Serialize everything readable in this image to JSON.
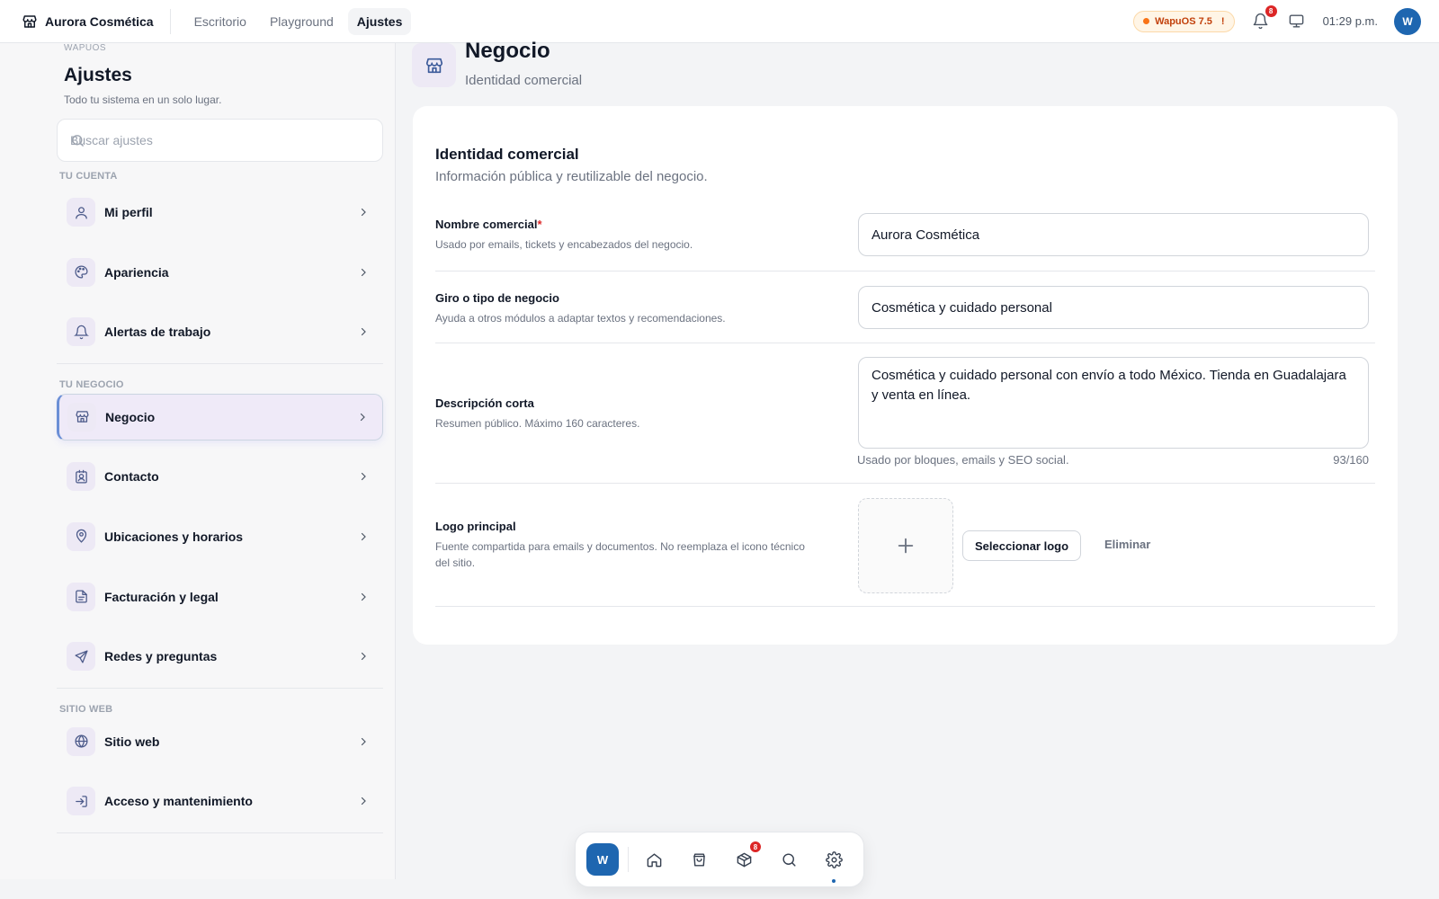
{
  "topbar": {
    "brand": "Aurora Cosmética",
    "nav": [
      "Escritorio",
      "Playground",
      "Ajustes"
    ],
    "os_badge": "WapuOS 7.5",
    "os_badge_alert": "!",
    "notifications_count": "8",
    "time": "01:29 p.m.",
    "avatar_initial": "W"
  },
  "sidebar": {
    "eyebrow": "WAPUOS",
    "title": "Ajustes",
    "subtitle": "Todo tu sistema en un solo lugar.",
    "search_placeholder": "Buscar ajustes",
    "sections": [
      {
        "label": "TU CUENTA",
        "items": [
          "Mi perfil",
          "Apariencia",
          "Alertas de trabajo"
        ]
      },
      {
        "label": "TU NEGOCIO",
        "items": [
          "Negocio",
          "Contacto",
          "Ubicaciones y horarios",
          "Facturación y legal",
          "Redes y preguntas"
        ]
      },
      {
        "label": "SITIO WEB",
        "items": [
          "Sitio web",
          "Acceso y mantenimiento"
        ]
      }
    ],
    "icons": [
      "user-icon",
      "palette-icon",
      "bell-icon",
      "store-icon",
      "contact-card-icon",
      "map-pin-icon",
      "document-icon",
      "send-icon",
      "globe-icon",
      "login-icon"
    ]
  },
  "page": {
    "title": "Negocio",
    "subtitle": "Identidad comercial"
  },
  "card": {
    "title": "Identidad comercial",
    "subtitle": "Información pública y reutilizable del negocio.",
    "fields": {
      "name": {
        "label": "Nombre comercial",
        "required_mark": "*",
        "help": "Usado por emails, tickets y encabezados del negocio.",
        "value": "Aurora Cosmética"
      },
      "type": {
        "label": "Giro o tipo de negocio",
        "help": "Ayuda a otros módulos a adaptar textos y recomendaciones.",
        "value": "Cosmética y cuidado personal"
      },
      "description": {
        "label": "Descripción corta",
        "help": "Resumen público. Máximo 160 caracteres.",
        "value": "Cosmética y cuidado personal con envío a todo México. Tienda en Guadalajara y venta en línea.",
        "usage_help": "Usado por bloques, emails y SEO social.",
        "counter": "93/160"
      },
      "logo": {
        "label": "Logo principal",
        "help": "Fuente compartida para emails y documentos. No reemplaza el icono técnico del sitio.",
        "select_label": "Seleccionar logo",
        "remove_label": "Eliminar"
      }
    }
  },
  "dock": {
    "launcher_label": "W",
    "items": [
      "home-icon",
      "shopping-bag-icon",
      "package-icon",
      "search-icon",
      "gear-icon"
    ],
    "package_badge": "8"
  },
  "colors": {
    "accent": "#1e66b0",
    "badge": "#dc2626",
    "os_badge_bg": "#fff5e6",
    "active_item_bg": "#efeaf8"
  }
}
